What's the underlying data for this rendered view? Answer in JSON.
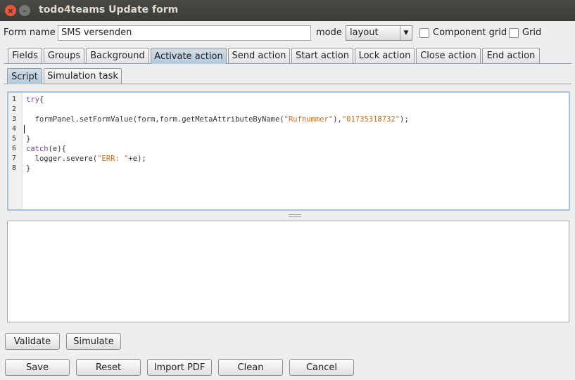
{
  "window": {
    "title": "todo4teams Update form",
    "close_glyph": "×",
    "minimize_glyph": "–"
  },
  "form": {
    "name_label": "Form name",
    "name_value": "SMS versenden",
    "mode_label": "mode",
    "mode_value": "layout",
    "component_grid_label": "Component grid",
    "component_grid_checked": false,
    "grid_label": "Grid",
    "grid_checked": false
  },
  "tabs": [
    {
      "label": "Fields",
      "active": false
    },
    {
      "label": "Groups",
      "active": false
    },
    {
      "label": "Background",
      "active": false
    },
    {
      "label": "Activate action",
      "active": true
    },
    {
      "label": "Send action",
      "active": false
    },
    {
      "label": "Start action",
      "active": false
    },
    {
      "label": "Lock action",
      "active": false
    },
    {
      "label": "Close action",
      "active": false
    },
    {
      "label": "End action",
      "active": false
    }
  ],
  "subtabs": [
    {
      "label": "Script",
      "active": true
    },
    {
      "label": "Simulation task",
      "active": false
    }
  ],
  "editor": {
    "line_numbers": [
      "1",
      "2",
      "3",
      "4",
      "5",
      "6",
      "7",
      "8"
    ],
    "lines": {
      "l1_kw": "try",
      "l1_rest": "{",
      "l3_code": "  formPanel.setFormValue(form,form.getMetaAttributeByName(",
      "l3_str1": "\"Rufnummer\"",
      "l3_mid": "),",
      "l3_str2": "\"01735318732\"",
      "l3_end": ");",
      "l5": "}",
      "l6_kw": "catch",
      "l6_rest": "(e){",
      "l7_code": "  logger.severe(",
      "l7_str": "\"ERR: \"",
      "l7_end": "+e);",
      "l8": "}"
    }
  },
  "buttons": {
    "validate": "Validate",
    "simulate": "Simulate",
    "save": "Save",
    "reset": "Reset",
    "import_pdf": "Import PDF",
    "clean": "Clean",
    "cancel": "Cancel"
  },
  "icons": {
    "dropdown": "▼"
  }
}
